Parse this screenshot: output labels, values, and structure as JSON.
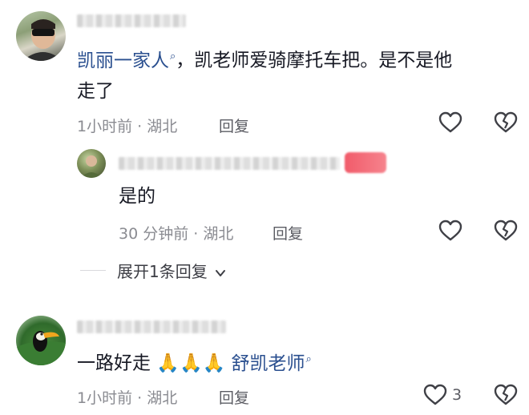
{
  "comments": [
    {
      "mention": "凯丽一家人",
      "text": "，凯老师爱骑摩托车把。是不是他",
      "text_line2": "走了",
      "meta": "1小时前 · 湖北",
      "reply_label": "回复"
    },
    {
      "text": "是的",
      "meta": "30 分钟前 · 湖北",
      "reply_label": "回复"
    },
    {
      "text": "一路好走",
      "emoji": "🙏🙏🙏",
      "mention": "舒凯老师",
      "meta": "1小时前 · 湖北",
      "reply_label": "回复",
      "like_count": "3"
    }
  ],
  "expand_replies": "展开1条回复",
  "icons": {
    "like": "heart-outline-icon",
    "dislike": "broken-heart-icon",
    "mention_search": "search-icon",
    "expand": "chevron-down-icon"
  },
  "colors": {
    "mention": "#2a4f8f",
    "meta": "#8a8b91",
    "badge": "#f15b6a"
  }
}
